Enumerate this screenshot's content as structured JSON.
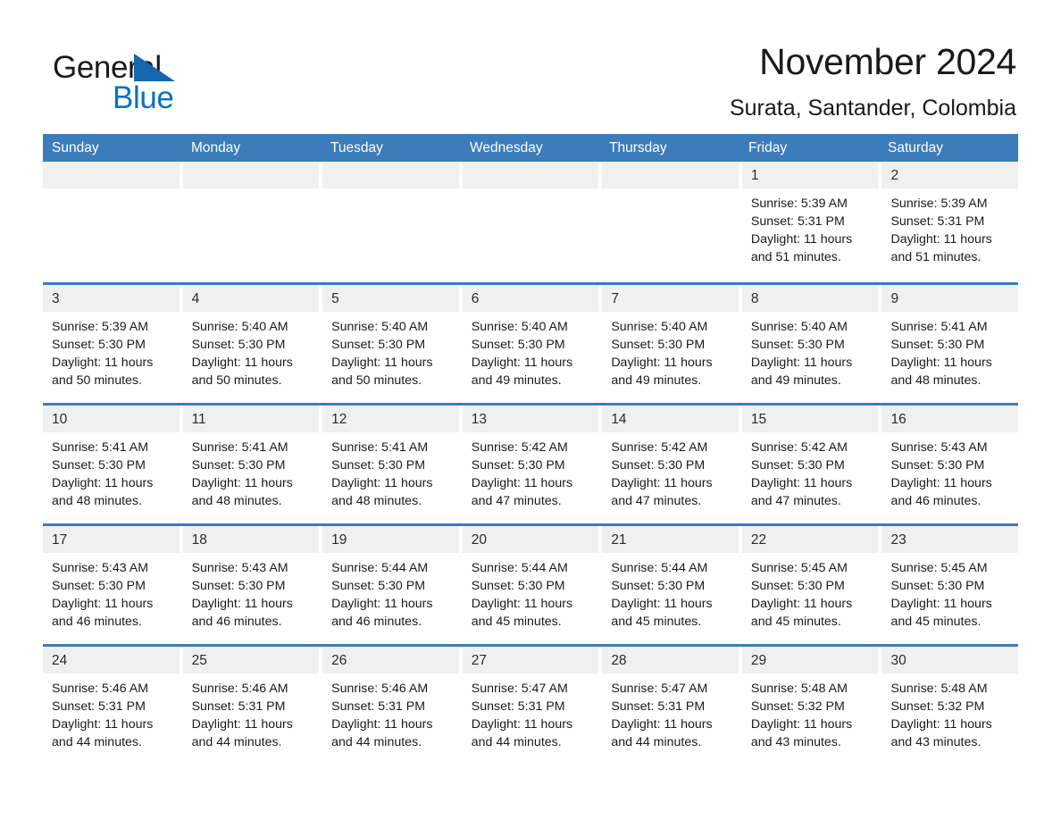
{
  "brand": {
    "name_dark": "General",
    "name_blue": "Blue",
    "triangle_color": "#1667ad"
  },
  "header": {
    "title": "November 2024",
    "location": "Surata, Santander, Colombia"
  },
  "calendar": {
    "accent_color": "#3d7cba",
    "daynum_bg": "#f0f0f0",
    "weekday_headers": [
      "Sunday",
      "Monday",
      "Tuesday",
      "Wednesday",
      "Thursday",
      "Friday",
      "Saturday"
    ],
    "weeks": [
      [
        {
          "day": "",
          "empty": true
        },
        {
          "day": "",
          "empty": true
        },
        {
          "day": "",
          "empty": true
        },
        {
          "day": "",
          "empty": true
        },
        {
          "day": "",
          "empty": true
        },
        {
          "day": "1",
          "sunrise": "Sunrise: 5:39 AM",
          "sunset": "Sunset: 5:31 PM",
          "daylight": "Daylight: 11 hours and 51 minutes."
        },
        {
          "day": "2",
          "sunrise": "Sunrise: 5:39 AM",
          "sunset": "Sunset: 5:31 PM",
          "daylight": "Daylight: 11 hours and 51 minutes."
        }
      ],
      [
        {
          "day": "3",
          "sunrise": "Sunrise: 5:39 AM",
          "sunset": "Sunset: 5:30 PM",
          "daylight": "Daylight: 11 hours and 50 minutes."
        },
        {
          "day": "4",
          "sunrise": "Sunrise: 5:40 AM",
          "sunset": "Sunset: 5:30 PM",
          "daylight": "Daylight: 11 hours and 50 minutes."
        },
        {
          "day": "5",
          "sunrise": "Sunrise: 5:40 AM",
          "sunset": "Sunset: 5:30 PM",
          "daylight": "Daylight: 11 hours and 50 minutes."
        },
        {
          "day": "6",
          "sunrise": "Sunrise: 5:40 AM",
          "sunset": "Sunset: 5:30 PM",
          "daylight": "Daylight: 11 hours and 49 minutes."
        },
        {
          "day": "7",
          "sunrise": "Sunrise: 5:40 AM",
          "sunset": "Sunset: 5:30 PM",
          "daylight": "Daylight: 11 hours and 49 minutes."
        },
        {
          "day": "8",
          "sunrise": "Sunrise: 5:40 AM",
          "sunset": "Sunset: 5:30 PM",
          "daylight": "Daylight: 11 hours and 49 minutes."
        },
        {
          "day": "9",
          "sunrise": "Sunrise: 5:41 AM",
          "sunset": "Sunset: 5:30 PM",
          "daylight": "Daylight: 11 hours and 48 minutes."
        }
      ],
      [
        {
          "day": "10",
          "sunrise": "Sunrise: 5:41 AM",
          "sunset": "Sunset: 5:30 PM",
          "daylight": "Daylight: 11 hours and 48 minutes."
        },
        {
          "day": "11",
          "sunrise": "Sunrise: 5:41 AM",
          "sunset": "Sunset: 5:30 PM",
          "daylight": "Daylight: 11 hours and 48 minutes."
        },
        {
          "day": "12",
          "sunrise": "Sunrise: 5:41 AM",
          "sunset": "Sunset: 5:30 PM",
          "daylight": "Daylight: 11 hours and 48 minutes."
        },
        {
          "day": "13",
          "sunrise": "Sunrise: 5:42 AM",
          "sunset": "Sunset: 5:30 PM",
          "daylight": "Daylight: 11 hours and 47 minutes."
        },
        {
          "day": "14",
          "sunrise": "Sunrise: 5:42 AM",
          "sunset": "Sunset: 5:30 PM",
          "daylight": "Daylight: 11 hours and 47 minutes."
        },
        {
          "day": "15",
          "sunrise": "Sunrise: 5:42 AM",
          "sunset": "Sunset: 5:30 PM",
          "daylight": "Daylight: 11 hours and 47 minutes."
        },
        {
          "day": "16",
          "sunrise": "Sunrise: 5:43 AM",
          "sunset": "Sunset: 5:30 PM",
          "daylight": "Daylight: 11 hours and 46 minutes."
        }
      ],
      [
        {
          "day": "17",
          "sunrise": "Sunrise: 5:43 AM",
          "sunset": "Sunset: 5:30 PM",
          "daylight": "Daylight: 11 hours and 46 minutes."
        },
        {
          "day": "18",
          "sunrise": "Sunrise: 5:43 AM",
          "sunset": "Sunset: 5:30 PM",
          "daylight": "Daylight: 11 hours and 46 minutes."
        },
        {
          "day": "19",
          "sunrise": "Sunrise: 5:44 AM",
          "sunset": "Sunset: 5:30 PM",
          "daylight": "Daylight: 11 hours and 46 minutes."
        },
        {
          "day": "20",
          "sunrise": "Sunrise: 5:44 AM",
          "sunset": "Sunset: 5:30 PM",
          "daylight": "Daylight: 11 hours and 45 minutes."
        },
        {
          "day": "21",
          "sunrise": "Sunrise: 5:44 AM",
          "sunset": "Sunset: 5:30 PM",
          "daylight": "Daylight: 11 hours and 45 minutes."
        },
        {
          "day": "22",
          "sunrise": "Sunrise: 5:45 AM",
          "sunset": "Sunset: 5:30 PM",
          "daylight": "Daylight: 11 hours and 45 minutes."
        },
        {
          "day": "23",
          "sunrise": "Sunrise: 5:45 AM",
          "sunset": "Sunset: 5:30 PM",
          "daylight": "Daylight: 11 hours and 45 minutes."
        }
      ],
      [
        {
          "day": "24",
          "sunrise": "Sunrise: 5:46 AM",
          "sunset": "Sunset: 5:31 PM",
          "daylight": "Daylight: 11 hours and 44 minutes."
        },
        {
          "day": "25",
          "sunrise": "Sunrise: 5:46 AM",
          "sunset": "Sunset: 5:31 PM",
          "daylight": "Daylight: 11 hours and 44 minutes."
        },
        {
          "day": "26",
          "sunrise": "Sunrise: 5:46 AM",
          "sunset": "Sunset: 5:31 PM",
          "daylight": "Daylight: 11 hours and 44 minutes."
        },
        {
          "day": "27",
          "sunrise": "Sunrise: 5:47 AM",
          "sunset": "Sunset: 5:31 PM",
          "daylight": "Daylight: 11 hours and 44 minutes."
        },
        {
          "day": "28",
          "sunrise": "Sunrise: 5:47 AM",
          "sunset": "Sunset: 5:31 PM",
          "daylight": "Daylight: 11 hours and 44 minutes."
        },
        {
          "day": "29",
          "sunrise": "Sunrise: 5:48 AM",
          "sunset": "Sunset: 5:32 PM",
          "daylight": "Daylight: 11 hours and 43 minutes."
        },
        {
          "day": "30",
          "sunrise": "Sunrise: 5:48 AM",
          "sunset": "Sunset: 5:32 PM",
          "daylight": "Daylight: 11 hours and 43 minutes."
        }
      ]
    ]
  }
}
